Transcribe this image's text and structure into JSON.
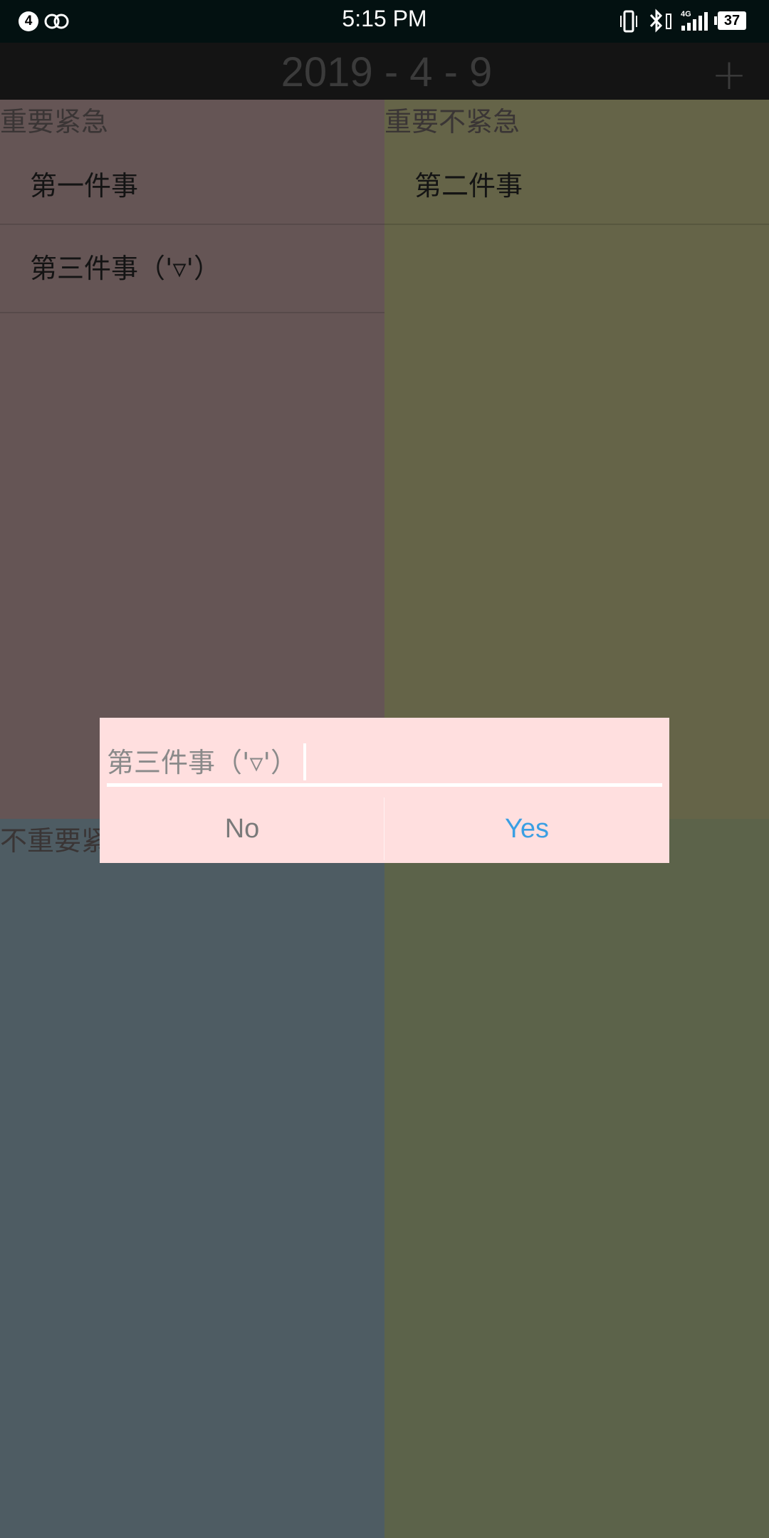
{
  "status_bar": {
    "notification_count": "4",
    "time": "5:15 PM",
    "network_label": "4G",
    "battery": "37"
  },
  "app_bar": {
    "title": "2019 - 4 - 9",
    "add_label": "+"
  },
  "quadrants": {
    "important_urgent": {
      "title": "重要紧急",
      "items": [
        "第一件事",
        "第三件事（'▿'）"
      ]
    },
    "important_not_urgent": {
      "title": "重要不紧急",
      "items": [
        "第二件事"
      ]
    },
    "not_important_urgent": {
      "title": "不重要紧急",
      "items": []
    },
    "not_important_not_urgent": {
      "title": "",
      "items": []
    }
  },
  "dialog": {
    "input_value": "第三件事（'▿'）",
    "no_label": "No",
    "yes_label": "Yes"
  },
  "colors": {
    "important_urgent": "#655555",
    "important_not_urgent": "#656448",
    "not_important_urgent": "#4e5c63",
    "not_important_not_urgent": "#5c634a",
    "dialog_bg": "#ffdfdf",
    "yes_accent": "#3b9fe3"
  }
}
